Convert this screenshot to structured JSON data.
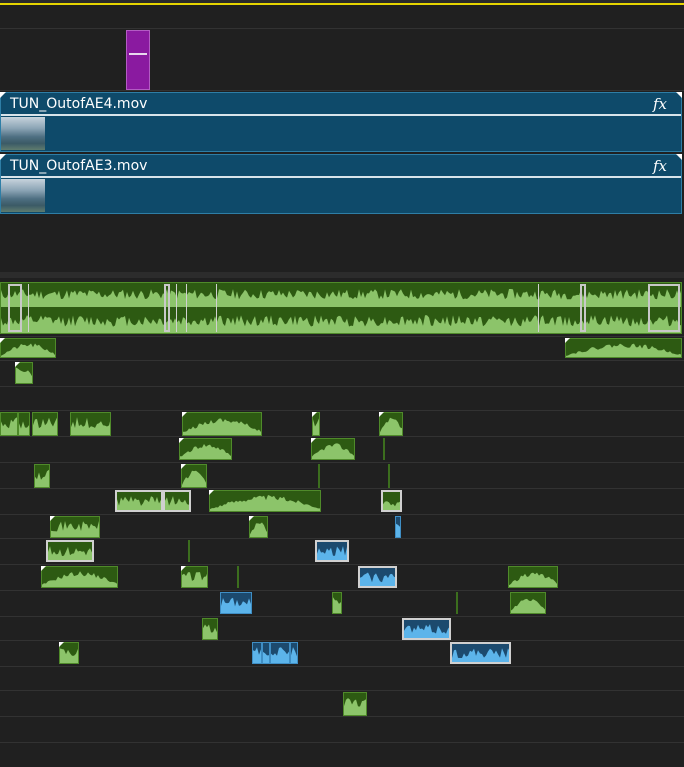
{
  "timeline": {
    "video_clips": [
      {
        "name": "TUN_OutofAE4.mov",
        "fx_label": "fx"
      },
      {
        "name": "TUN_OutofAE3.mov",
        "fx_label": "fx"
      }
    ],
    "colors": {
      "background": "#202020",
      "playhead_range": "#e6d400",
      "video_clip": "#0e4a6a",
      "graphics_clip": "#8a1aa0",
      "audio_clip_green": "#2d5a12",
      "audio_wave_green": "#8cc46a",
      "audio_clip_blue": "#1c4a6e",
      "audio_wave_blue": "#5cb4ea"
    }
  }
}
